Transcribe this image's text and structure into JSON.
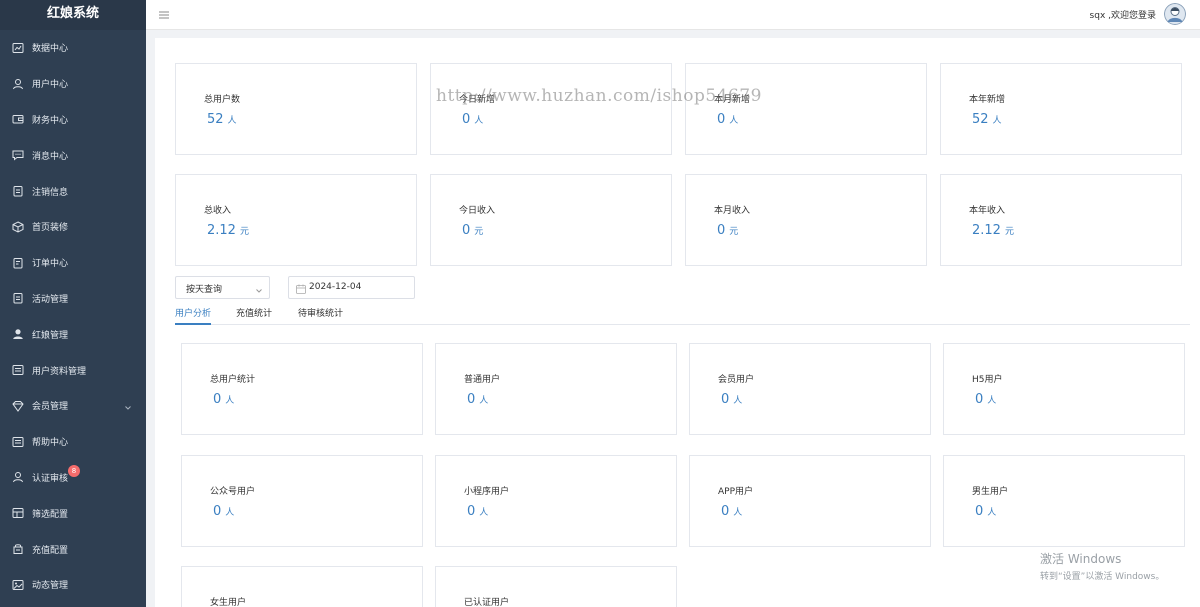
{
  "app": {
    "title": "红娘系统"
  },
  "header": {
    "greeting": "sqx ,欢迎您登录"
  },
  "sidebar": {
    "items": [
      {
        "label": "数据中心",
        "icon": "chart-icon"
      },
      {
        "label": "用户中心",
        "icon": "user-icon"
      },
      {
        "label": "财务中心",
        "icon": "wallet-icon"
      },
      {
        "label": "消息中心",
        "icon": "message-icon"
      },
      {
        "label": "注销信息",
        "icon": "clipboard-icon"
      },
      {
        "label": "首页装修",
        "icon": "box-icon"
      },
      {
        "label": "订单中心",
        "icon": "order-icon"
      },
      {
        "label": "活动管理",
        "icon": "clipboard-icon"
      },
      {
        "label": "红娘管理",
        "icon": "person-solid-icon"
      },
      {
        "label": "用户资料管理",
        "icon": "grid-icon"
      },
      {
        "label": "会员管理",
        "icon": "member-icon"
      },
      {
        "label": "帮助中心",
        "icon": "grid-icon"
      },
      {
        "label": "认证审核",
        "icon": "user-icon",
        "badge": "8"
      },
      {
        "label": "筛选配置",
        "icon": "filter-icon"
      },
      {
        "label": "充值配置",
        "icon": "recharge-icon"
      },
      {
        "label": "动态管理",
        "icon": "image-icon"
      }
    ]
  },
  "stats_top": [
    {
      "title": "总用户数",
      "value": "52",
      "unit": "人"
    },
    {
      "title": "今日新增",
      "value": "0",
      "unit": "人"
    },
    {
      "title": "本月新增",
      "value": "0",
      "unit": "人"
    },
    {
      "title": "本年新增",
      "value": "52",
      "unit": "人"
    },
    {
      "title": "总收入",
      "value": "2.12",
      "unit": "元"
    },
    {
      "title": "今日收入",
      "value": "0",
      "unit": "元"
    },
    {
      "title": "本月收入",
      "value": "0",
      "unit": "元"
    },
    {
      "title": "本年收入",
      "value": "2.12",
      "unit": "元"
    }
  ],
  "filters": {
    "mode": "按天查询",
    "date": "2024-12-04"
  },
  "tabs": [
    {
      "label": "用户分析",
      "active": true
    },
    {
      "label": "充值统计",
      "active": false
    },
    {
      "label": "待审核统计",
      "active": false
    }
  ],
  "stats_users": [
    {
      "title": "总用户统计",
      "value": "0",
      "unit": "人"
    },
    {
      "title": "普通用户",
      "value": "0",
      "unit": "人"
    },
    {
      "title": "会员用户",
      "value": "0",
      "unit": "人"
    },
    {
      "title": "H5用户",
      "value": "0",
      "unit": "人"
    },
    {
      "title": "公众号用户",
      "value": "0",
      "unit": "人"
    },
    {
      "title": "小程序用户",
      "value": "0",
      "unit": "人"
    },
    {
      "title": "APP用户",
      "value": "0",
      "unit": "人"
    },
    {
      "title": "男生用户",
      "value": "0",
      "unit": "人"
    },
    {
      "title": "女生用户",
      "value": "",
      "unit": ""
    },
    {
      "title": "已认证用户",
      "value": "",
      "unit": ""
    }
  ],
  "watermark": "http://www.huzhan.com/ishop54679",
  "os_notice": {
    "line1": "激活 Windows",
    "line2": "转到“设置”以激活 Windows。"
  },
  "colors": {
    "sidebar": "#2f3f52",
    "accent": "#3a7fc1",
    "badge": "#f56c6c"
  }
}
